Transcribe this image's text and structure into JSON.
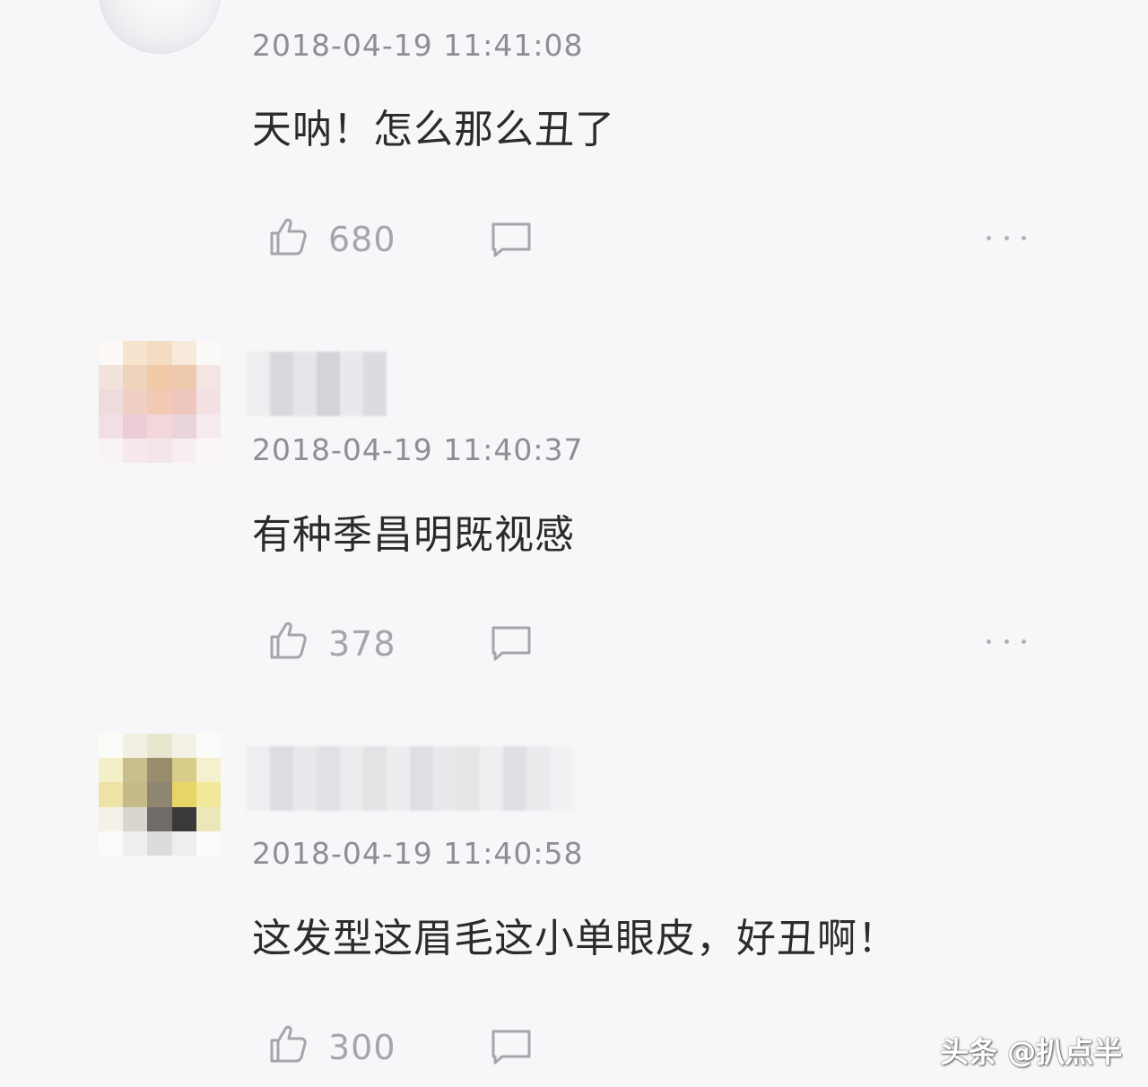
{
  "comments": [
    {
      "timestamp": "2018-04-19 11:41:08",
      "text": "天呐！怎么那么丑了",
      "likes": "680",
      "avatar_icon": "user-avatar",
      "username_obscured": true
    },
    {
      "timestamp": "2018-04-19 11:40:37",
      "text": "有种季昌明既视感",
      "likes": "378",
      "avatar_icon": "user-avatar-pixelated",
      "username_obscured": true
    },
    {
      "timestamp": "2018-04-19 11:40:58",
      "text": "这发型这眉毛这小单眼皮，好丑啊！",
      "likes": "300",
      "avatar_icon": "user-avatar-pixelated",
      "username_obscured": true
    }
  ],
  "icons": {
    "like": "thumbs-up-icon",
    "reply": "comment-bubble-icon",
    "more": "more-dots-icon"
  },
  "colors": {
    "background": "#f7f7fa",
    "timestamp": "#8e8e93",
    "text": "#2b2b2b",
    "icon": "#a5a5aa"
  },
  "watermark": "头条 @扒点半"
}
